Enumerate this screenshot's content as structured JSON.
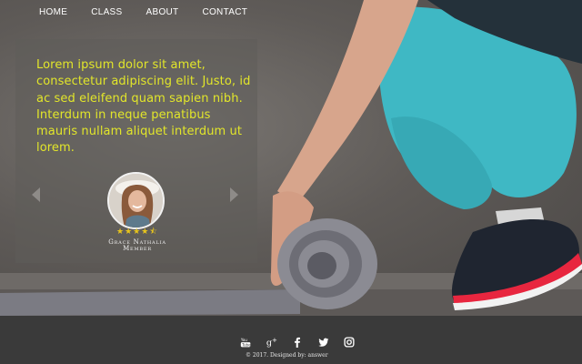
{
  "nav": {
    "items": [
      {
        "label": "HOME"
      },
      {
        "label": "CLASS"
      },
      {
        "label": "ABOUT"
      },
      {
        "label": "CONTACT"
      }
    ]
  },
  "testimonial": {
    "quote": "Lorem ipsum dolor sit amet, consectetur adipiscing elit. Justo, id ac sed eleifend quam sapien nibh. Interdum in neque penatibus mauris nullam aliquet interdum ut lorem.",
    "rating": 4.5,
    "rating_max": 5,
    "name": "Grace Nathalia",
    "role": "Member"
  },
  "footer": {
    "socials": [
      "youtube-icon",
      "google-plus-icon",
      "facebook-icon",
      "twitter-icon",
      "instagram-icon"
    ],
    "copyright": "© 2017. Designed by: answer"
  },
  "colors": {
    "quote_text": "#e2e62a",
    "star": "#e8c51c",
    "footer_bg": "#3a3a3a",
    "leggings": "#3fb8c4",
    "shoe_sole": "#e8263f"
  }
}
